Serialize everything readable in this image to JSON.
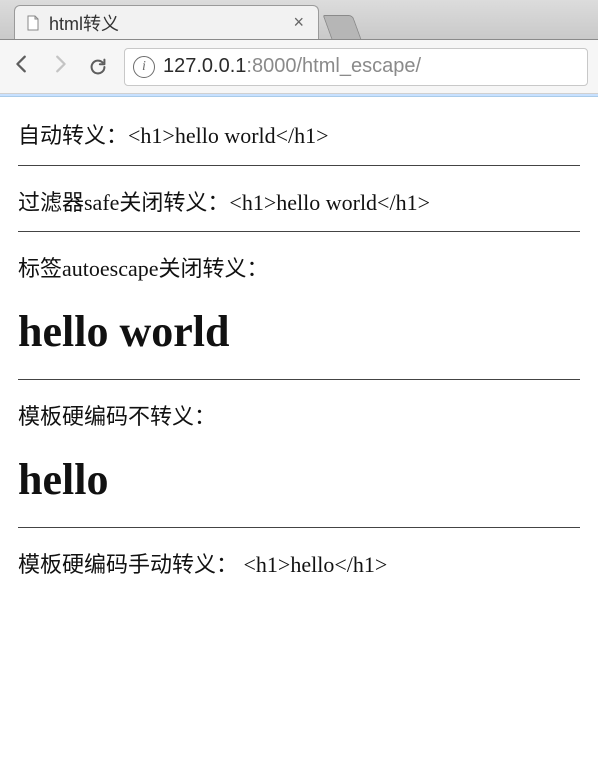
{
  "tab": {
    "title": "html转义",
    "close_glyph": "×"
  },
  "url": {
    "host": "127.0.0.1",
    "port": ":8000",
    "path": "/html_escape/"
  },
  "info_glyph": "i",
  "content": {
    "line1_label": "自动转义：",
    "line1_value": "<h1>hello world</h1>",
    "line2_label": "过滤器safe关闭转义：",
    "line2_value": "<h1>hello world</h1>",
    "line3_label": "标签autoescape关闭转义：",
    "h1_a": "hello world",
    "line4_label": "模板硬编码不转义：",
    "h1_b": "hello",
    "line5_label": "模板硬编码手动转义：",
    "line5_value": " <h1>hello</h1>"
  }
}
